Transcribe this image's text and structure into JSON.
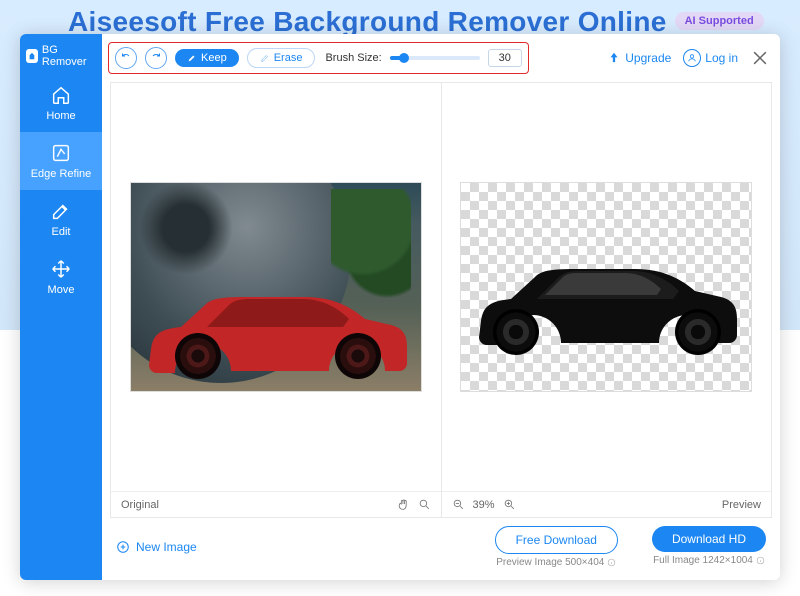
{
  "banner": {
    "title": "Aiseesoft Free Background Remover Online",
    "badge": "AI Supported"
  },
  "brand": "BG Remover",
  "sidebar": {
    "items": [
      {
        "label": "Home"
      },
      {
        "label": "Edge Refine"
      },
      {
        "label": "Edit"
      },
      {
        "label": "Move"
      }
    ]
  },
  "toolbar": {
    "keep_label": "Keep",
    "erase_label": "Erase",
    "brush_label": "Brush Size:",
    "brush_value": "30"
  },
  "account": {
    "upgrade": "Upgrade",
    "login": "Log in"
  },
  "panels": {
    "left_label": "Original",
    "right_label": "Preview",
    "zoom_pct": "39%"
  },
  "actions": {
    "new_image": "New Image",
    "free_dl": "Free Download",
    "free_meta": "Preview Image 500×404",
    "hd_dl": "Download HD",
    "hd_meta": "Full Image 1242×1004"
  }
}
